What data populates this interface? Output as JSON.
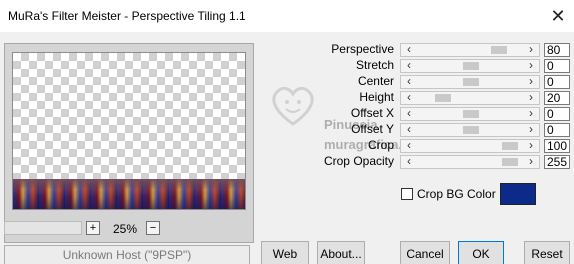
{
  "window": {
    "title": "MuRa's Filter Meister - Perspective Tiling 1.1",
    "close_glyph": "✕"
  },
  "preview": {
    "zoom": "25%",
    "zoom_in": "+",
    "zoom_out": "−"
  },
  "params": [
    {
      "label": "Perspective",
      "value": "80",
      "fraction": 0.8
    },
    {
      "label": "Stretch",
      "value": "0",
      "fraction": 0.5
    },
    {
      "label": "Center",
      "value": "0",
      "fraction": 0.5
    },
    {
      "label": "Height",
      "value": "20",
      "fraction": 0.2
    },
    {
      "label": "Offset X",
      "value": "0",
      "fraction": 0.5
    },
    {
      "label": "Offset Y",
      "value": "0",
      "fraction": 0.5
    },
    {
      "label": "Crop",
      "value": "100",
      "fraction": 0.92
    },
    {
      "label": "Crop Opacity",
      "value": "255",
      "fraction": 0.92
    }
  ],
  "crop_bg": {
    "label": "Crop BG Color",
    "checked": false,
    "color": "#0c2a8a"
  },
  "status": "Unknown Host (\"9PSP\")",
  "buttons": {
    "web": "Web",
    "about": "About...",
    "cancel": "Cancel",
    "ok": "OK",
    "reset": "Reset"
  },
  "watermark": {
    "line1": "Pinuccia",
    "line2": "muragrafica.eu"
  }
}
